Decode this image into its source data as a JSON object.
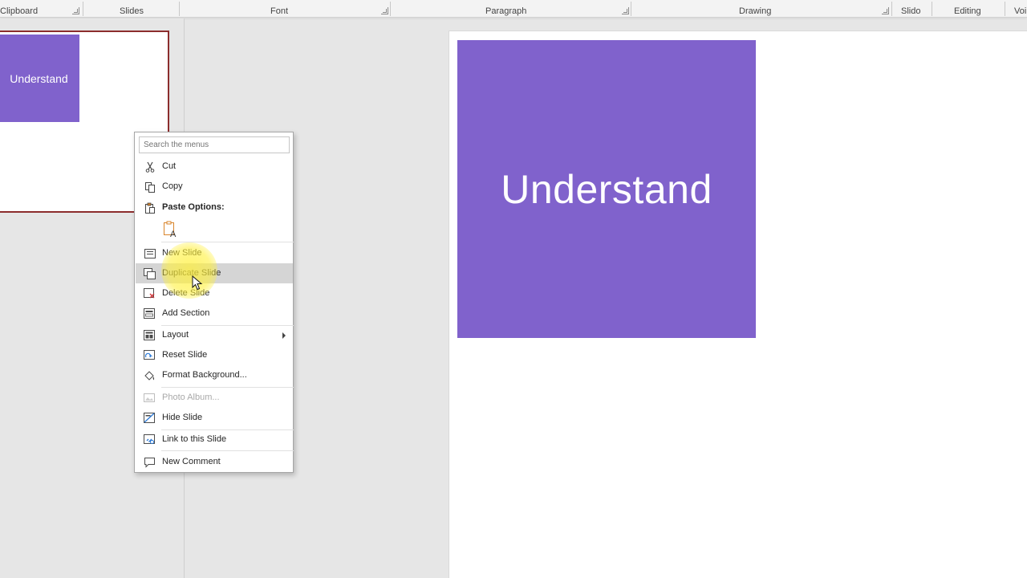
{
  "ribbon": {
    "groups": [
      "Clipboard",
      "Slides",
      "Font",
      "Paragraph",
      "Drawing",
      "Slido",
      "Editing",
      "Voi"
    ]
  },
  "thumbnail": {
    "box_text": "Understand"
  },
  "slide": {
    "box_text": "Understand",
    "box_color": "#8062cc"
  },
  "context_menu": {
    "search_placeholder": "Search the menus",
    "items": {
      "cut": "Cut",
      "copy": "Copy",
      "paste_options": "Paste Options:",
      "new_slide": "New Slide",
      "duplicate_slide": "Duplicate Slide",
      "delete_slide": "Delete Slide",
      "add_section": "Add Section",
      "layout": "Layout",
      "reset_slide": "Reset Slide",
      "format_background": "Format Background...",
      "photo_album": "Photo Album...",
      "hide_slide": "Hide Slide",
      "link_to_slide": "Link to this Slide",
      "new_comment": "New Comment"
    }
  }
}
